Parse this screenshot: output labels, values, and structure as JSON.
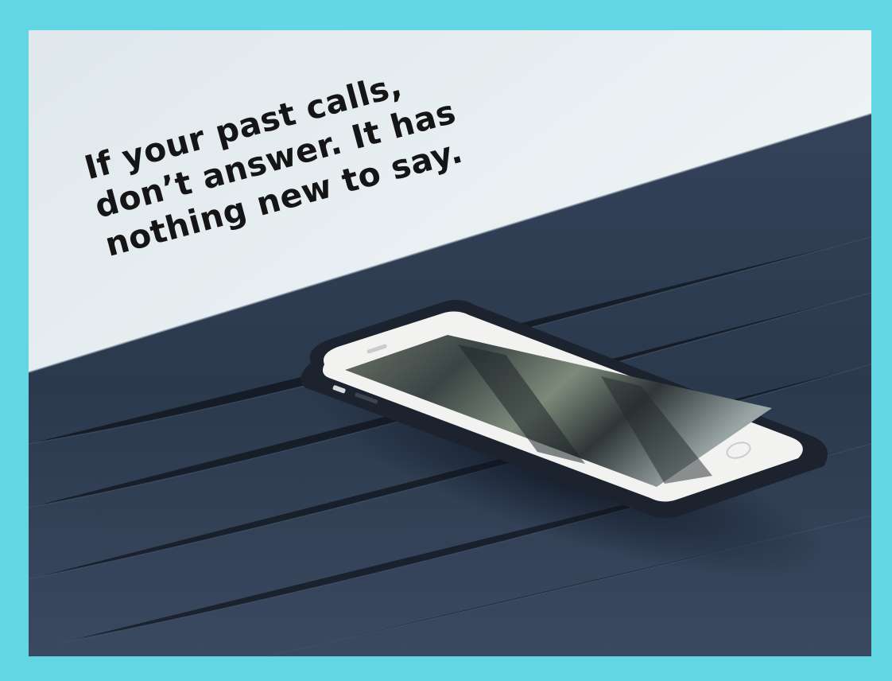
{
  "quote": {
    "lines": [
      "If your past calls,",
      "don’t answer. It has",
      "nothing new to say."
    ]
  },
  "colors": {
    "border": "#62d6e3",
    "sky": "#e6eef1",
    "table": "#2c3a4f",
    "text": "#151515"
  }
}
